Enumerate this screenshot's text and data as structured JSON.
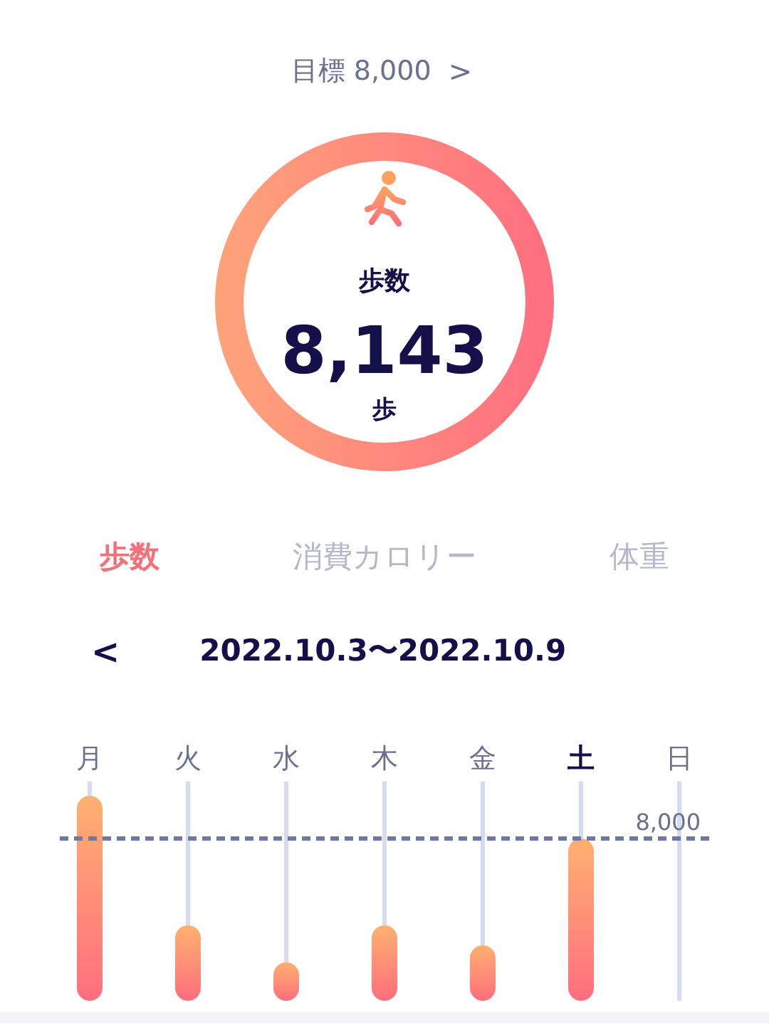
{
  "goal": {
    "label": "目標 8,000",
    "chevron": ">"
  },
  "ring": {
    "level": 1,
    "title": "歩数",
    "value": "8,143",
    "unit": "歩"
  },
  "tabs": [
    {
      "label": "歩数",
      "selected": true
    },
    {
      "label": "消費カロリー",
      "selected": false
    },
    {
      "label": "体重",
      "selected": false
    }
  ],
  "period": {
    "prev": "<",
    "range": "2022.10.3〜2022.10.9"
  },
  "chart": {
    "goal_label": "8,000",
    "days": [
      {
        "label": "月",
        "selected": false
      },
      {
        "label": "火",
        "selected": false
      },
      {
        "label": "水",
        "selected": false
      },
      {
        "label": "木",
        "selected": false
      },
      {
        "label": "金",
        "selected": false
      },
      {
        "label": "土",
        "selected": true
      },
      {
        "label": "日",
        "selected": false
      }
    ]
  }
}
